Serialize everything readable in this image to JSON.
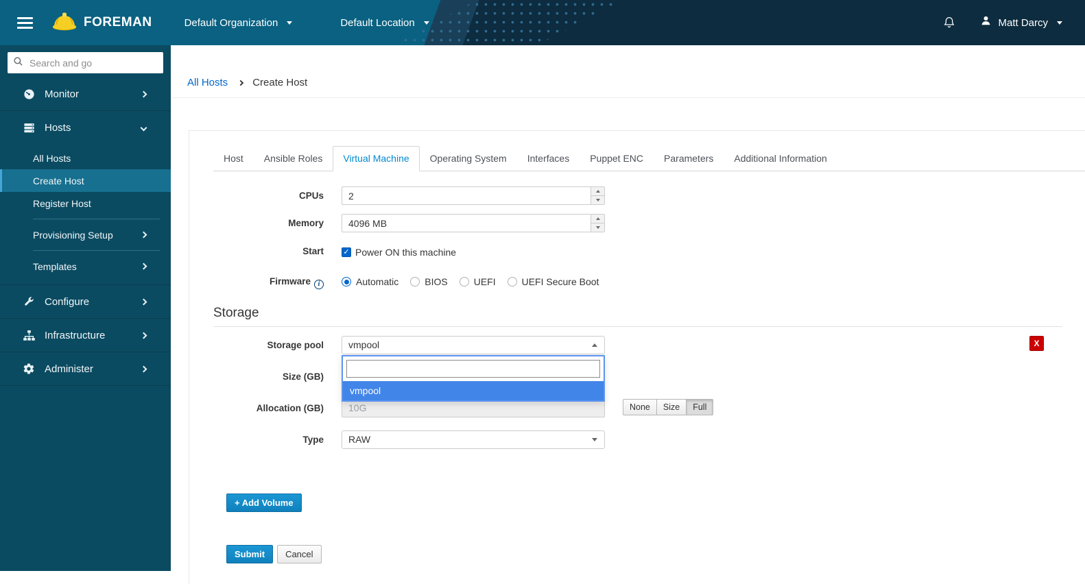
{
  "colors": {
    "accent": "#0088ce",
    "link": "#0066cc",
    "selected_option": "#4285e8",
    "danger": "#cc0000",
    "masthead_teal": "#0a6181",
    "masthead_navy": "#0d2c3f",
    "sidebar_bg": "#0b4b61"
  },
  "masthead": {
    "brand": "FOREMAN",
    "org_selector": "Default Organization",
    "loc_selector": "Default Location",
    "user_name": "Matt Darcy"
  },
  "sidebar": {
    "search_placeholder": "Search and go",
    "items": [
      {
        "label": "Monitor",
        "icon": "gauge-icon"
      },
      {
        "label": "Hosts",
        "icon": "server-icon",
        "expanded": true
      },
      {
        "label": "Configure",
        "icon": "wrench-icon"
      },
      {
        "label": "Infrastructure",
        "icon": "sitemap-icon"
      },
      {
        "label": "Administer",
        "icon": "gear-icon"
      }
    ],
    "hosts_children": [
      {
        "label": "All Hosts"
      },
      {
        "label": "Create Host",
        "active": true
      },
      {
        "label": "Register Host"
      },
      {
        "label": "Provisioning Setup"
      },
      {
        "label": "Templates"
      }
    ]
  },
  "breadcrumb": {
    "parent": "All Hosts",
    "current": "Create Host"
  },
  "tabs": {
    "items": [
      "Host",
      "Ansible Roles",
      "Virtual Machine",
      "Operating System",
      "Interfaces",
      "Puppet ENC",
      "Parameters",
      "Additional Information"
    ],
    "active": "Virtual Machine"
  },
  "form": {
    "cpus": {
      "label": "CPUs",
      "value": "2"
    },
    "memory": {
      "label": "Memory",
      "value": "4096 MB"
    },
    "start": {
      "label": "Start",
      "option": "Power ON this machine",
      "checked": true
    },
    "firmware": {
      "label": "Firmware",
      "options": [
        "Automatic",
        "BIOS",
        "UEFI",
        "UEFI Secure Boot"
      ],
      "selected": "Automatic"
    },
    "storage": {
      "heading": "Storage",
      "pool": {
        "label": "Storage pool",
        "value": "vmpool"
      },
      "pool_dropdown": {
        "search_value": "",
        "options": [
          "vmpool"
        ],
        "highlighted": "vmpool"
      },
      "size": {
        "label": "Size (GB)"
      },
      "allocation": {
        "label": "Allocation (GB)",
        "value": "10G",
        "modes": [
          "None",
          "Size",
          "Full"
        ],
        "active_mode": "Full"
      },
      "type": {
        "label": "Type",
        "value": "RAW"
      },
      "remove_button": "X"
    },
    "add_volume_button": "+ Add Volume",
    "submit_button": "Submit",
    "cancel_button": "Cancel"
  }
}
